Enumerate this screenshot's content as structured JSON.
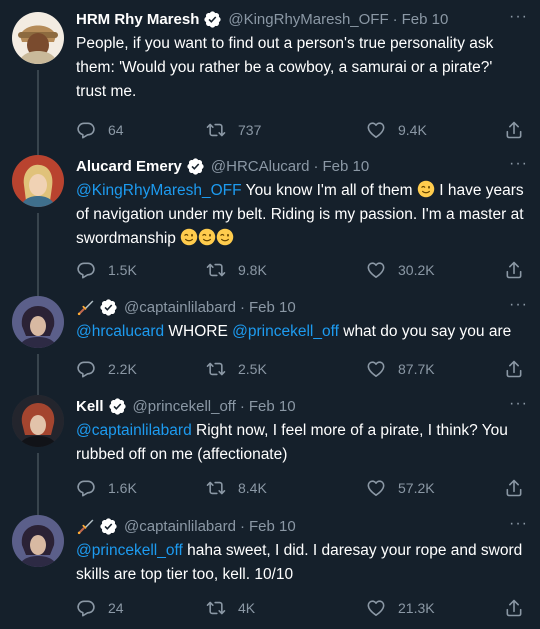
{
  "tweets": [
    {
      "name": "HRM Rhy Maresh",
      "handle": "@KingRhyMaresh_OFF",
      "date": "Feb 10",
      "text": "People, if you want to find out a person's true personality ask them: 'Would you rather be a cowboy, a samurai or a pirate?' trust me.",
      "replies": "64",
      "retweets": "737",
      "likes": "9.4K",
      "more": "···"
    },
    {
      "name": "Alucard Emery",
      "handle": "@HRCAlucard",
      "date": "Feb 10",
      "mention": "@KingRhyMaresh_OFF",
      "text_1": " You know I'm all of them ",
      "text_2": " I have years of navigation under my belt. Riding is my passion. I'm a master at swordmanship ",
      "replies": "1.5K",
      "retweets": "9.8K",
      "likes": "30.2K",
      "more": "···"
    },
    {
      "handle": "@captainlilabard",
      "date": "Feb 10",
      "mention_1": "@hrcalucard",
      "text_1": " WHORE ",
      "mention_2": "@princekell_off",
      "text_2": " what do you say you are",
      "replies": "2.2K",
      "retweets": "2.5K",
      "likes": "87.7K",
      "more": "···"
    },
    {
      "name": "Kell",
      "handle": "@princekell_off",
      "date": "Feb 10",
      "mention": "@captainlilabard",
      "text": " Right now, I feel more of a pirate, I think? You rubbed off on me (affectionate)",
      "replies": "1.6K",
      "retweets": "8.4K",
      "likes": "57.2K",
      "more": "···"
    },
    {
      "handle": "@captainlilabard",
      "date": "Feb 10",
      "mention": "@princekell_off",
      "text": " haha sweet, I did. I daresay your rope and sword skills are top tier too, kell. 10/10",
      "replies": "24",
      "retweets": "4K",
      "likes": "21.3K",
      "more": "···"
    }
  ],
  "separator": "·",
  "colors": {
    "background": "#15202b",
    "text": "#ffffff",
    "muted": "#8b98a5",
    "link": "#1d9bf0",
    "thread_line": "#38444d"
  }
}
